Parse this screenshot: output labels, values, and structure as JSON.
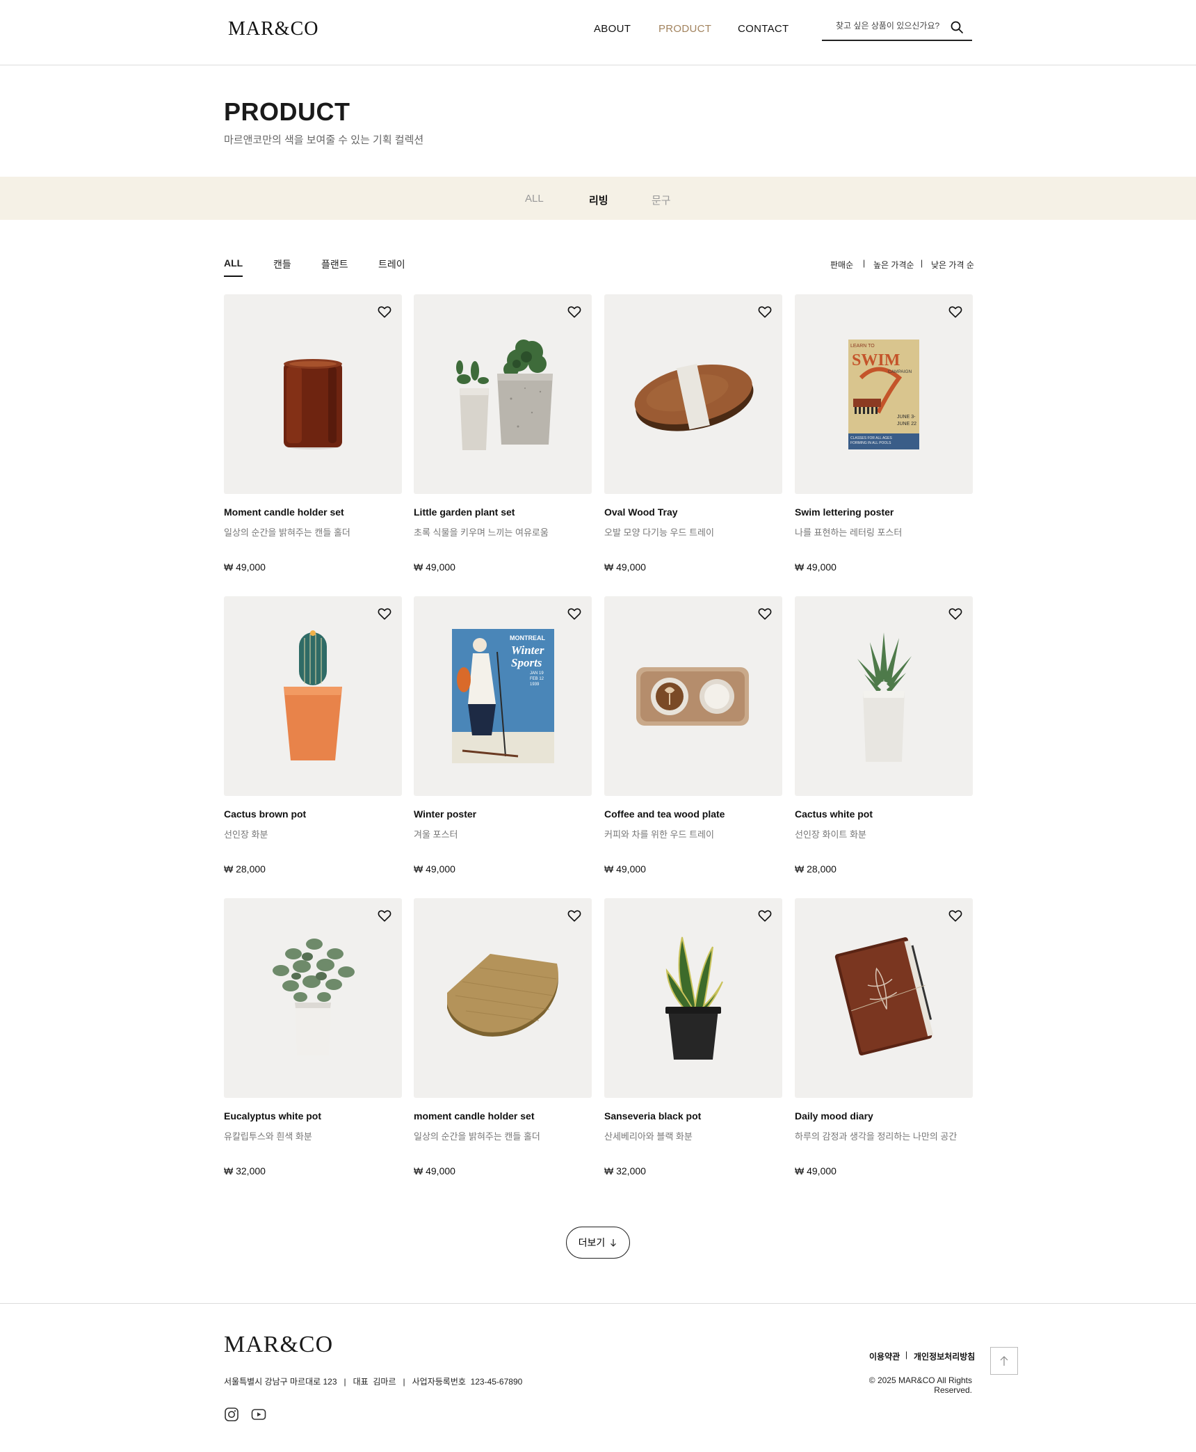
{
  "header": {
    "logo": "MAR&CO",
    "nav": [
      {
        "label": "ABOUT"
      },
      {
        "label": "PRODUCT",
        "active": true
      },
      {
        "label": "CONTACT"
      }
    ],
    "search_placeholder": "찾고 싶은 상품이 있으신가요?"
  },
  "page": {
    "title": "PRODUCT",
    "subtitle": "마르앤코만의 색을 보여줄 수 있는 기획 컬렉션"
  },
  "categories": [
    {
      "label": "ALL"
    },
    {
      "label": "리빙",
      "active": true
    },
    {
      "label": "문구"
    }
  ],
  "filters": [
    {
      "label": "ALL",
      "active": true
    },
    {
      "label": "캔들"
    },
    {
      "label": "플랜트"
    },
    {
      "label": "트레이"
    }
  ],
  "sort": [
    "판매순",
    "높은 가격순",
    "낮은 가격 순"
  ],
  "sort_separator": "|",
  "products": [
    {
      "name": "Moment candle holder set",
      "desc": "일상의 순간을 밝혀주는 캔들 홀더",
      "price": "₩ 49,000",
      "art": "candle-image"
    },
    {
      "name": "Little garden plant set",
      "desc": "초록 식물을 키우며 느끼는 여유로움",
      "price": "₩ 49,000",
      "art": "plant-set-image"
    },
    {
      "name": "Oval Wood Tray",
      "desc": "오발 모양 다기능 우드 트레이",
      "price": "₩ 49,000",
      "art": "oval-tray-image"
    },
    {
      "name": "Swim lettering poster",
      "desc": "나를 표현하는 레터링 포스터",
      "price": "₩ 49,000",
      "art": "swim-poster-image"
    },
    {
      "name": "Cactus brown pot",
      "desc": "선인장 화분",
      "price": "₩ 28,000",
      "art": "cactus-brown-image"
    },
    {
      "name": "Winter poster",
      "desc": "겨울 포스터",
      "price": "₩ 49,000",
      "art": "winter-poster-image"
    },
    {
      "name": "Coffee and tea wood plate",
      "desc": "커피와 차를 위한 우드 트레이",
      "price": "₩ 49,000",
      "art": "coffee-plate-image"
    },
    {
      "name": "Cactus white pot",
      "desc": "선인장 화이트 화분",
      "price": "₩ 28,000",
      "art": "cactus-white-image"
    },
    {
      "name": "Eucalyptus white pot",
      "desc": "유칼립투스와 흰색 화분",
      "price": "₩ 32,000",
      "art": "eucalyptus-image"
    },
    {
      "name": "moment candle holder set",
      "desc": "일상의 순간을 밝혀주는 캔들 홀더",
      "price": "₩ 49,000",
      "art": "wood-board-image"
    },
    {
      "name": "Sanseveria black pot",
      "desc": "산세베리아와 블랙 화분",
      "price": "₩ 32,000",
      "art": "sanseveria-image"
    },
    {
      "name": "Daily mood diary",
      "desc": "하루의 감정과 생각을 정리하는 나만의 공간",
      "price": "₩ 49,000",
      "art": "diary-image"
    }
  ],
  "poster_text": {
    "swim": {
      "line1": "LEARN TO",
      "line2": "SWIM",
      "line3": "CAMPAIGN",
      "line4": "JUNE 3-",
      "line5": "JUNE 22",
      "line6": "CLASSES FOR ALL AGES",
      "line7": "FORMING IN ALL POOLS"
    },
    "winter": {
      "line1": "MONTREAL",
      "line2": "Winter",
      "line3": "Sports",
      "line4": "JAN 19",
      "line5": "FEB 12",
      "line6": "1939"
    }
  },
  "more_button": {
    "label": "더보기",
    "icon": "arrow-down-icon"
  },
  "footer": {
    "logo": "MAR&CO",
    "info": "서울특별시 강남구 마르대로 123   |   대표  김마르   |   사업자등록번호  123-45-67890",
    "links": [
      "이용약관",
      "개인정보처리방침"
    ],
    "link_separator": "|",
    "copyright": "© 2025 MAR&CO All Rights Reserved.",
    "social": [
      "instagram-icon",
      "youtube-icon"
    ]
  },
  "colors": {
    "accent": "#a2835e",
    "band": "#f5f1e6",
    "card_bg": "#f1f0ee",
    "text": "#111111",
    "muted": "#777777"
  }
}
